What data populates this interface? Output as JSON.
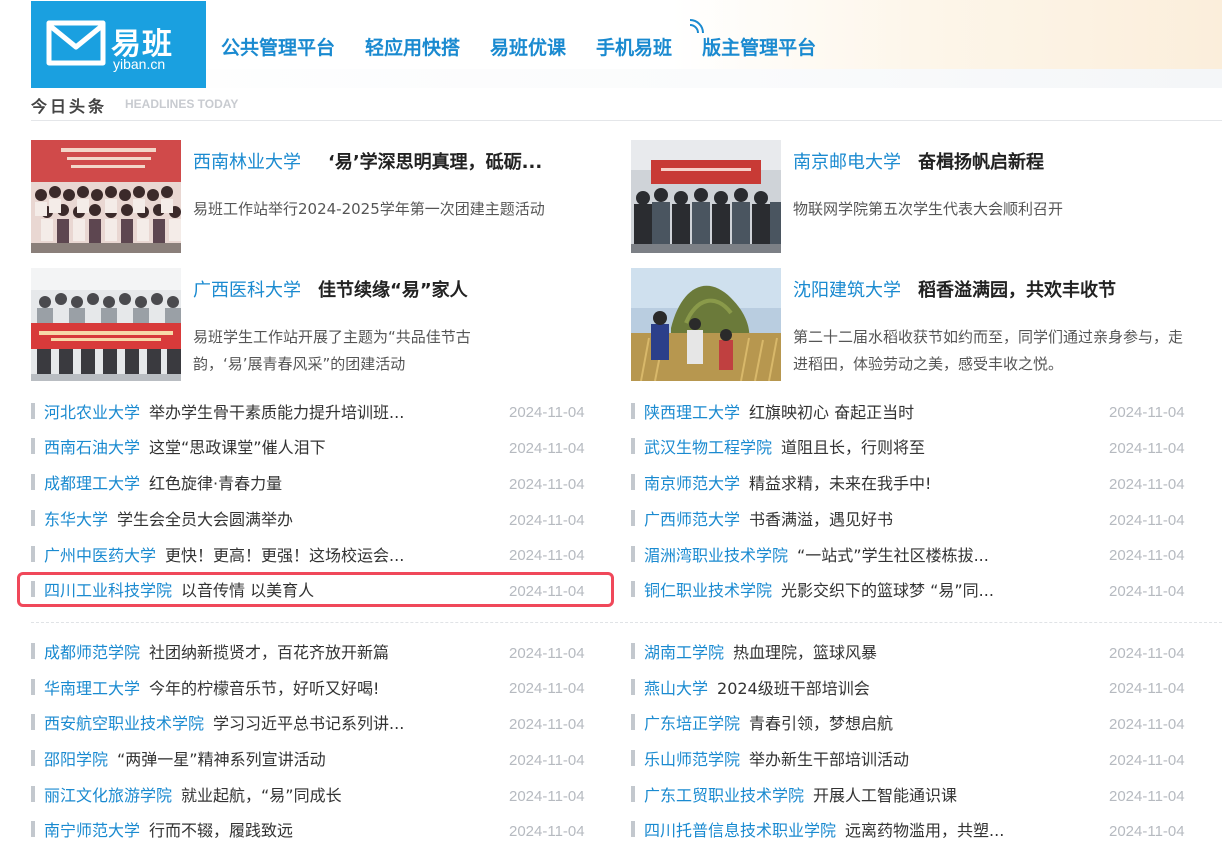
{
  "logo": {
    "name": "易班",
    "domain": "yiban.cn"
  },
  "nav": [
    "公共管理平台",
    "轻应用快搭",
    "易班优课",
    "手机易班",
    "版主管理平台"
  ],
  "section": {
    "title": "今日头条",
    "subtitle": "HEADLINES TODAY"
  },
  "featured": [
    {
      "school": "西南林业大学",
      "title": "‘易’学深思明真理，砥砺...",
      "desc_lines": [
        "易班工作站举行2024-2025学年第一次团建主题活动"
      ]
    },
    {
      "school": "南京邮电大学",
      "title": "奋楫扬帆启新程",
      "desc_lines": [
        "物联网学院第五次学生代表大会顺利召开"
      ]
    },
    {
      "school": "广西医科大学",
      "title": "佳节续缘“易”家人",
      "desc_lines": [
        "易班学生工作站开展了主题为“共品佳节古",
        "韵，‘易’展青春风采”的团建活动"
      ]
    },
    {
      "school": "沈阳建筑大学",
      "title": "稻香溢满园，共欢丰收节",
      "desc_lines": [
        "第二十二届水稻收获节如约而至，同学们通过亲身参与，走",
        "进稻田，体验劳动之美，感受丰收之悦。"
      ]
    }
  ],
  "list_left_1": [
    {
      "school": "河北农业大学",
      "title": "举办学生骨干素质能力提升培训班...",
      "date": "2024-11-04"
    },
    {
      "school": "西南石油大学",
      "title": "这堂“思政课堂”催人泪下",
      "date": "2024-11-04"
    },
    {
      "school": "成都理工大学",
      "title": "红色旋律·青春力量",
      "date": "2024-11-04"
    },
    {
      "school": "东华大学",
      "title": "学生会全员大会圆满举办",
      "date": "2024-11-04"
    },
    {
      "school": "广州中医药大学",
      "title": "更快！更高！更强！这场校运会...",
      "date": "2024-11-04"
    },
    {
      "school": "四川工业科技学院",
      "title": "以音传情 以美育人",
      "date": "2024-11-04"
    }
  ],
  "list_right_1": [
    {
      "school": "陕西理工大学",
      "title": "红旗映初心 奋起正当时",
      "date": "2024-11-04"
    },
    {
      "school": "武汉生物工程学院",
      "title": "道阻且长，行则将至",
      "date": "2024-11-04"
    },
    {
      "school": "南京师范大学",
      "title": "精益求精，未来在我手中!",
      "date": "2024-11-04"
    },
    {
      "school": "广西师范大学",
      "title": "书香满溢，遇见好书",
      "date": "2024-11-04"
    },
    {
      "school": "湄洲湾职业技术学院",
      "title": "“一站式”学生社区楼栋拔...",
      "date": "2024-11-04"
    },
    {
      "school": "铜仁职业技术学院",
      "title": "光影交织下的篮球梦 “易”同...",
      "date": "2024-11-04"
    }
  ],
  "list_left_2": [
    {
      "school": "成都师范学院",
      "title": "社团纳新揽贤才，百花齐放开新篇",
      "date": "2024-11-04"
    },
    {
      "school": "华南理工大学",
      "title": "今年的柠檬音乐节，好听又好喝!",
      "date": "2024-11-04"
    },
    {
      "school": "西安航空职业技术学院",
      "title": "学习习近平总书记系列讲...",
      "date": "2024-11-04"
    },
    {
      "school": "邵阳学院",
      "title": "“两弹一星”精神系列宣讲活动",
      "date": "2024-11-04"
    },
    {
      "school": "丽江文化旅游学院",
      "title": "就业起航，“易”同成长",
      "date": "2024-11-04"
    },
    {
      "school": "南宁师范大学",
      "title": "行而不辍，履践致远",
      "date": "2024-11-04"
    }
  ],
  "list_right_2": [
    {
      "school": "湖南工学院",
      "title": "热血理院，篮球风暴",
      "date": "2024-11-04"
    },
    {
      "school": "燕山大学",
      "title": "2024级班干部培训会",
      "date": "2024-11-04"
    },
    {
      "school": "广东培正学院",
      "title": "青春引领，梦想启航",
      "date": "2024-11-04"
    },
    {
      "school": "乐山师范学院",
      "title": "举办新生干部培训活动",
      "date": "2024-11-04"
    },
    {
      "school": "广东工贸职业技术学院",
      "title": "开展人工智能通识课",
      "date": "2024-11-04"
    },
    {
      "school": "四川托普信息技术职业学院",
      "title": "远离药物滥用，共塑...",
      "date": "2024-11-04"
    }
  ],
  "colors": {
    "brand": "#1aa0e0",
    "link": "#1a8ad0",
    "highlight": "#f0485a"
  }
}
